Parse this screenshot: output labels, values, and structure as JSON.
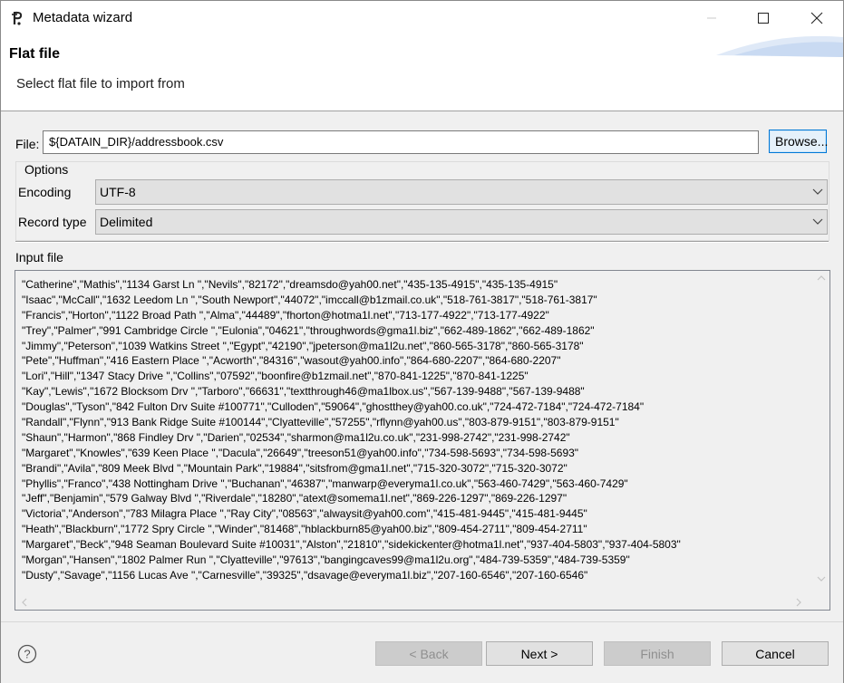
{
  "window": {
    "title": "Metadata wizard"
  },
  "header": {
    "title": "Flat file",
    "description": "Select flat file to import from"
  },
  "file": {
    "label": "File:",
    "value": "${DATAIN_DIR}/addressbook.csv",
    "browse_label": "Browse..."
  },
  "options": {
    "group_title": "Options",
    "encoding_label": "Encoding",
    "encoding_value": "UTF-8",
    "record_type_label": "Record type",
    "record_type_value": "Delimited"
  },
  "input_file": {
    "label": "Input file",
    "lines": [
      "\"Catherine\",\"Mathis\",\"1134 Garst Ln \",\"Nevils\",\"82172\",\"dreamsdo@yah00.net\",\"435-135-4915\",\"435-135-4915\"",
      "\"Isaac\",\"McCall\",\"1632 Leedom Ln \",\"South Newport\",\"44072\",\"imccall@b1zmail.co.uk\",\"518-761-3817\",\"518-761-3817\"",
      "\"Francis\",\"Horton\",\"1122 Broad Path \",\"Alma\",\"44489\",\"fhorton@hotma1l.net\",\"713-177-4922\",\"713-177-4922\"",
      "\"Trey\",\"Palmer\",\"991 Cambridge Circle \",\"Eulonia\",\"04621\",\"throughwords@gma1l.biz\",\"662-489-1862\",\"662-489-1862\"",
      "\"Jimmy\",\"Peterson\",\"1039 Watkins Street \",\"Egypt\",\"42190\",\"jpeterson@ma1l2u.net\",\"860-565-3178\",\"860-565-3178\"",
      "\"Pete\",\"Huffman\",\"416 Eastern Place \",\"Acworth\",\"84316\",\"wasout@yah00.info\",\"864-680-2207\",\"864-680-2207\"",
      "\"Lori\",\"Hill\",\"1347 Stacy Drive \",\"Collins\",\"07592\",\"boonfire@b1zmail.net\",\"870-841-1225\",\"870-841-1225\"",
      "\"Kay\",\"Lewis\",\"1672 Blocksom Drv \",\"Tarboro\",\"66631\",\"textthrough46@ma1lbox.us\",\"567-139-9488\",\"567-139-9488\"",
      "\"Douglas\",\"Tyson\",\"842 Fulton Drv Suite #100771\",\"Culloden\",\"59064\",\"ghostthey@yah00.co.uk\",\"724-472-7184\",\"724-472-7184\"",
      "\"Randall\",\"Flynn\",\"913 Bank Ridge Suite #100144\",\"Clyatteville\",\"57255\",\"rflynn@yah00.us\",\"803-879-9151\",\"803-879-9151\"",
      "\"Shaun\",\"Harmon\",\"868 Findley Drv \",\"Darien\",\"02534\",\"sharmon@ma1l2u.co.uk\",\"231-998-2742\",\"231-998-2742\"",
      "\"Margaret\",\"Knowles\",\"639 Keen Place \",\"Dacula\",\"26649\",\"treeson51@yah00.info\",\"734-598-5693\",\"734-598-5693\"",
      "\"Brandi\",\"Avila\",\"809 Meek Blvd \",\"Mountain Park\",\"19884\",\"sitsfrom@gma1l.net\",\"715-320-3072\",\"715-320-3072\"",
      "\"Phyllis\",\"Franco\",\"438 Nottingham Drive \",\"Buchanan\",\"46387\",\"manwarp@everyma1l.co.uk\",\"563-460-7429\",\"563-460-7429\"",
      "\"Jeff\",\"Benjamin\",\"579 Galway Blvd \",\"Riverdale\",\"18280\",\"atext@somema1l.net\",\"869-226-1297\",\"869-226-1297\"",
      "\"Victoria\",\"Anderson\",\"783 Milagra Place \",\"Ray City\",\"08563\",\"alwaysit@yah00.com\",\"415-481-9445\",\"415-481-9445\"",
      "\"Heath\",\"Blackburn\",\"1772 Spry Circle \",\"Winder\",\"81468\",\"hblackburn85@yah00.biz\",\"809-454-2711\",\"809-454-2711\"",
      "\"Margaret\",\"Beck\",\"948 Seaman Boulevard Suite #10031\",\"Alston\",\"21810\",\"sidekickenter@hotma1l.net\",\"937-404-5803\",\"937-404-5803\"",
      "\"Morgan\",\"Hansen\",\"1802 Palmer Run \",\"Clyatteville\",\"97613\",\"bangingcaves99@ma1l2u.org\",\"484-739-5359\",\"484-739-5359\"",
      "\"Dusty\",\"Savage\",\"1156 Lucas Ave \",\"Carnesville\",\"39325\",\"dsavage@everyma1l.biz\",\"207-160-6546\",\"207-160-6546\""
    ]
  },
  "buttons": {
    "back": "< Back",
    "next": "Next >",
    "finish": "Finish",
    "cancel": "Cancel"
  },
  "icons": {
    "app": "app-logo-icon",
    "help": "help-icon"
  },
  "colors": {
    "accent": "#0078d7",
    "dialog_bg": "#f0f0f0"
  }
}
